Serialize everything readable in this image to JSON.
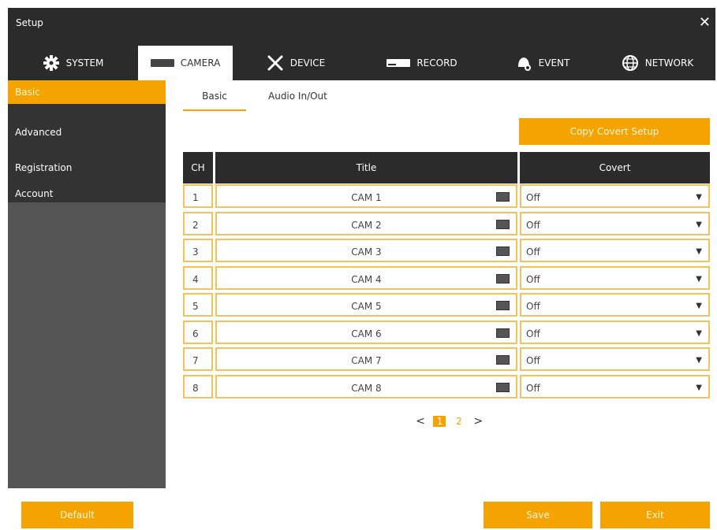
{
  "window": {
    "title": "Setup",
    "close_glyph": "✕"
  },
  "tabs": [
    {
      "label": "SYSTEM",
      "icon": "gear-icon"
    },
    {
      "label": "CAMERA",
      "icon": "camera-icon",
      "active": true
    },
    {
      "label": "DEVICE",
      "icon": "tools-icon"
    },
    {
      "label": "RECORD",
      "icon": "record-icon"
    },
    {
      "label": "EVENT",
      "icon": "bell-icon"
    },
    {
      "label": "NETWORK",
      "icon": "globe-icon"
    }
  ],
  "sidebar": {
    "items": [
      {
        "label": "Basic",
        "active": true
      },
      {
        "label": "Advanced"
      },
      {
        "label": "Registration"
      },
      {
        "label": "Account"
      }
    ]
  },
  "subtabs": [
    {
      "label": "Basic",
      "active": true
    },
    {
      "label": "Audio In/Out"
    }
  ],
  "copy_button": "Copy Covert Setup",
  "table": {
    "headers": {
      "ch": "CH",
      "title": "Title",
      "covert": "Covert"
    },
    "rows": [
      {
        "ch": "1",
        "title": "CAM 1",
        "covert": "Off"
      },
      {
        "ch": "2",
        "title": "CAM 2",
        "covert": "Off"
      },
      {
        "ch": "3",
        "title": "CAM 3",
        "covert": "Off"
      },
      {
        "ch": "4",
        "title": "CAM 4",
        "covert": "Off"
      },
      {
        "ch": "5",
        "title": "CAM 5",
        "covert": "Off"
      },
      {
        "ch": "6",
        "title": "CAM 6",
        "covert": "Off"
      },
      {
        "ch": "7",
        "title": "CAM 7",
        "covert": "Off"
      },
      {
        "ch": "8",
        "title": "CAM 8",
        "covert": "Off"
      }
    ]
  },
  "pagination": {
    "prev": "<",
    "pages": [
      "1",
      "2"
    ],
    "current": "1",
    "next": ">"
  },
  "buttons": {
    "default": "Default",
    "save": "Save",
    "exit": "Exit"
  },
  "colors": {
    "accent": "#f5a300",
    "dark": "#2b2b2b",
    "sidebar": "#555555",
    "cell_border": "#f5c25a"
  }
}
